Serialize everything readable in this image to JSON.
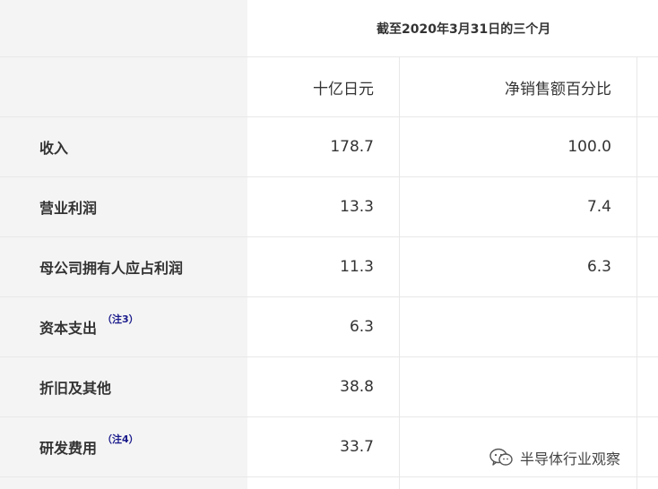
{
  "header": {
    "period": "截至2020年3月31日的三个月",
    "unit_yen": "十亿日元",
    "unit_pct": "净销售额百分比"
  },
  "rows": [
    {
      "label": "收入",
      "note": "",
      "yen": "178.7",
      "pct": "100.0"
    },
    {
      "label": "营业利润",
      "note": "",
      "yen": "13.3",
      "pct": "7.4"
    },
    {
      "label": "母公司拥有人应占利润",
      "note": "",
      "yen": "11.3",
      "pct": "6.3"
    },
    {
      "label": "资本支出",
      "note": "（注3）",
      "yen": "6.3",
      "pct": ""
    },
    {
      "label": "折旧及其他",
      "note": "",
      "yen": "38.8",
      "pct": ""
    },
    {
      "label": "研发费用",
      "note": "（注4）",
      "yen": "33.7",
      "pct": ""
    }
  ],
  "watermark": {
    "text": "半导体行业观察",
    "icon": "wechat-icon"
  }
}
